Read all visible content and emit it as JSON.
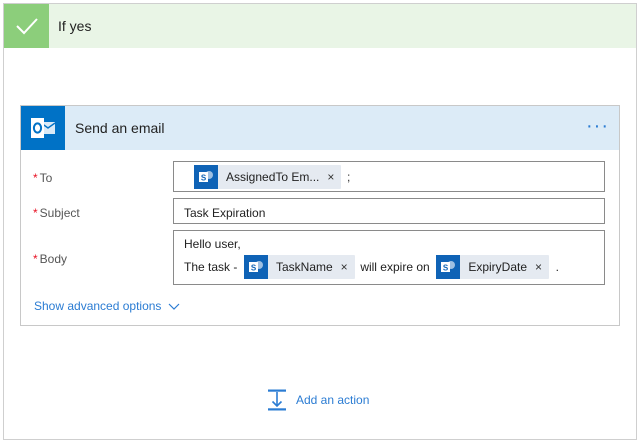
{
  "branch": {
    "title": "If yes",
    "accent_color": "#8cce7b",
    "icon": "checkmark-icon"
  },
  "action_card": {
    "title": "Send an email",
    "icon": "outlook-icon",
    "more_label": "···",
    "fields": {
      "to": {
        "required_mark": "*",
        "label": "To",
        "token": "AssignedTo Em...",
        "token_remove": "×",
        "suffix": ";"
      },
      "subject": {
        "required_mark": "*",
        "label": "Subject",
        "value": "Task Expiration"
      },
      "body": {
        "required_mark": "*",
        "label": "Body",
        "line1": "Hello user,",
        "text_before": "The task -",
        "token1": "TaskName",
        "text_middle": "will expire on",
        "token2": "ExpiryDate",
        "token_remove": "×",
        "text_after": "."
      }
    },
    "advanced_options": "Show advanced options"
  },
  "add_action_label": "Add an action",
  "colors": {
    "link": "#2b7cd3",
    "header_bg": "#dcebf7",
    "token_bg": "#e5eaf1",
    "sharepoint": "#0f63b6",
    "outlook": "#0072c6",
    "required": "#e81123"
  }
}
